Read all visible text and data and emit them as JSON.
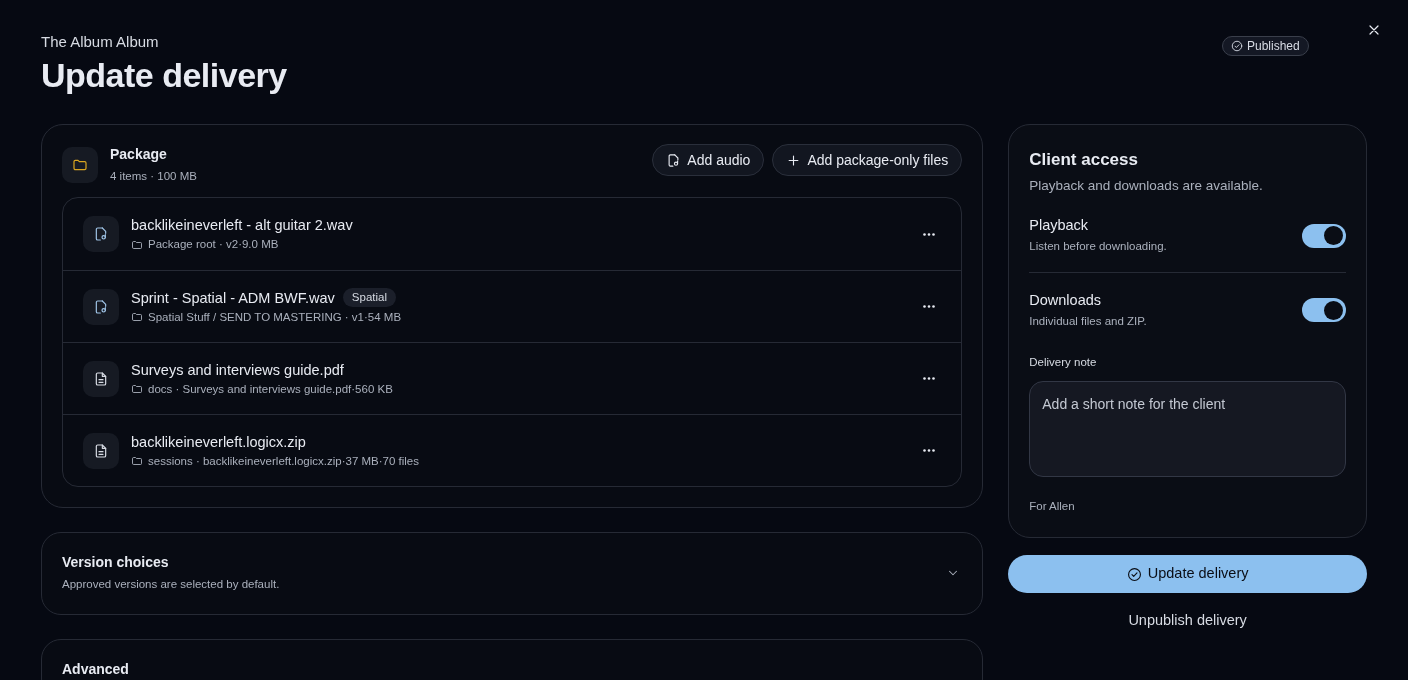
{
  "header": {
    "subtitle": "The Album Album",
    "title": "Update delivery",
    "status": "Published"
  },
  "package": {
    "title": "Package",
    "summary": "4 items · 100 MB",
    "actions": [
      {
        "kind": "audio",
        "label": "Add audio"
      },
      {
        "kind": "add",
        "label": "Add package-only files"
      }
    ],
    "files": [
      {
        "kind": "audio",
        "name": "backlikeineverleft - alt guitar 2.wav",
        "meta": "Package root · v2·9.0 MB"
      },
      {
        "kind": "audio",
        "name": "Sprint - Spatial - ADM BWF.wav",
        "tag": "Spatial",
        "meta": "Spatial Stuff / SEND TO MASTERING · v1·54 MB"
      },
      {
        "kind": "document",
        "name": "Surveys and interviews guide.pdf",
        "meta": "docs · Surveys and interviews guide.pdf·560 KB"
      },
      {
        "kind": "document",
        "name": "backlikeineverleft.logicx.zip",
        "meta": "sessions · backlikeineverleft.logicx.zip·37 MB·70 files"
      }
    ]
  },
  "sections": [
    {
      "title": "Version choices",
      "description": "Approved versions are selected by default.",
      "expanded": false
    },
    {
      "title": "Advanced"
    }
  ],
  "client_access": {
    "title": "Client access",
    "description": "Playback and downloads are available.",
    "toggles": [
      {
        "label": "Playback",
        "hint": "Listen before downloading.",
        "on": true
      },
      {
        "label": "Downloads",
        "hint": "Individual files and ZIP.",
        "on": true
      }
    ],
    "note_label": "Delivery note",
    "note_placeholder": "Add a short note for the client",
    "recipient": "For Allen"
  },
  "primary_button": "Update delivery",
  "secondary_button": "Unpublish delivery"
}
